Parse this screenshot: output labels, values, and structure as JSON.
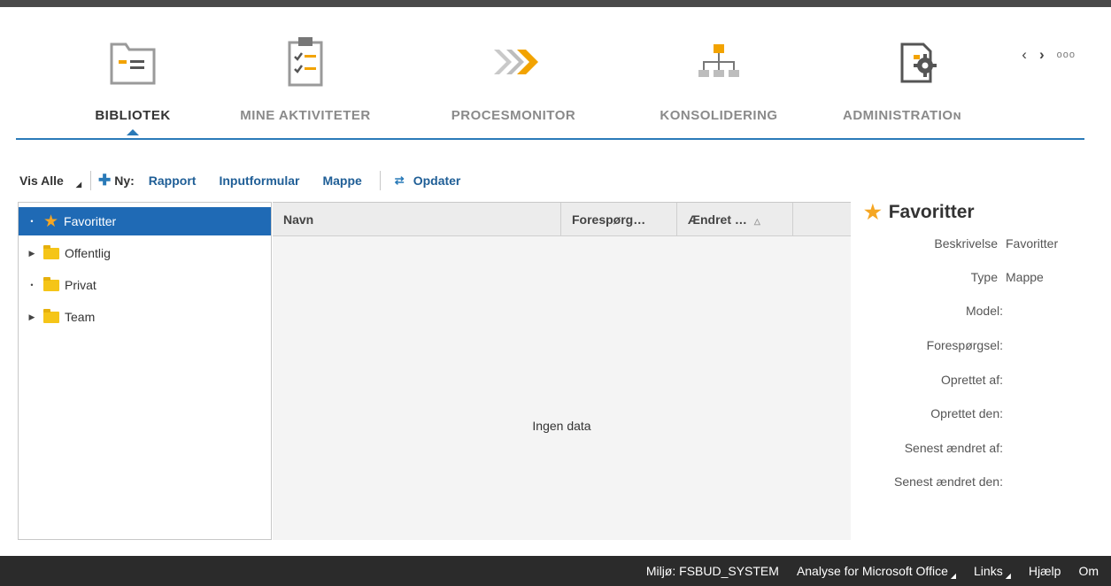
{
  "nav": {
    "items": [
      {
        "label": "BIBLIOTEK",
        "icon": "library-folder-icon"
      },
      {
        "label": "MINE AKTIVITETER",
        "icon": "clipboard-checklist-icon"
      },
      {
        "label": "PROCESMONITOR",
        "icon": "process-chevrons-icon"
      },
      {
        "label": "KONSOLIDERING",
        "icon": "hierarchy-icon"
      },
      {
        "label": "ADMINISTRATIOɴ",
        "icon": "admin-gear-document-icon"
      }
    ],
    "prev_icon": "‹",
    "next_icon": "›",
    "more_label": "ooo"
  },
  "toolbar": {
    "vis_alle": "Vis Alle",
    "ny": "Ny:",
    "rapport": "Rapport",
    "inputformular": "Inputformular",
    "mappe": "Mappe",
    "opdater": "Opdater"
  },
  "tree": {
    "items": [
      {
        "label": "Favoritter",
        "expander": "•",
        "icon": "star-icon",
        "selected": true
      },
      {
        "label": "Offentlig",
        "expander": "▶",
        "icon": "folder-icon",
        "selected": false
      },
      {
        "label": "Privat",
        "expander": "•",
        "icon": "folder-icon",
        "selected": false
      },
      {
        "label": "Team",
        "expander": "▶",
        "icon": "folder-icon",
        "selected": false
      }
    ]
  },
  "table": {
    "columns": [
      "Navn",
      "Forespørg…",
      "Ændret …",
      ""
    ],
    "empty_text": "Ingen data"
  },
  "details": {
    "title": "Favoritter",
    "rows": [
      {
        "key": "Beskrivelse",
        "value": "Favoritter"
      },
      {
        "key": "Type",
        "value": "Mappe"
      },
      {
        "key": "Model:",
        "value": ""
      },
      {
        "key": "Forespørgsel:",
        "value": ""
      },
      {
        "key": "Oprettet af:",
        "value": ""
      },
      {
        "key": "Oprettet den:",
        "value": ""
      },
      {
        "key": "Senest ændret af:",
        "value": ""
      },
      {
        "key": "Senest ændret den:",
        "value": ""
      }
    ]
  },
  "footer": {
    "environment": "Miljø: FSBUD_SYSTEM",
    "analysis": "Analyse for Microsoft Office",
    "links": "Links",
    "help": "Hjælp",
    "about": "Om"
  },
  "colors": {
    "accent": "#2a7ab8",
    "selection": "#1f6ab5",
    "star": "#f5a623",
    "folder": "#f5c518",
    "footer_bg": "#2b2b2b"
  }
}
